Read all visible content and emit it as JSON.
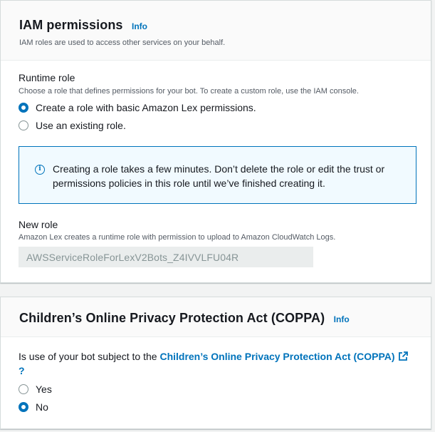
{
  "iam": {
    "title": "IAM permissions",
    "info": "Info",
    "description": "IAM roles are used to access other services on your behalf.",
    "runtime_role": {
      "label": "Runtime role",
      "description": "Choose a role that defines permissions for your bot. To create a custom role, use the IAM console.",
      "options": [
        {
          "label": "Create a role with basic Amazon Lex permissions.",
          "selected": true
        },
        {
          "label": "Use an existing role.",
          "selected": false
        }
      ]
    },
    "alert": {
      "icon": "info-circle-icon",
      "text": "Creating a role takes a few minutes. Don’t delete the role or edit the trust or permissions policies in this role until we’ve finished creating it."
    },
    "new_role": {
      "label": "New role",
      "description": "Amazon Lex creates a runtime role with permission to upload to Amazon CloudWatch Logs.",
      "value": "AWSServiceRoleForLexV2Bots_Z4IVVLFU04R"
    }
  },
  "coppa": {
    "title": "Children’s Online Privacy Protection Act (COPPA)",
    "info": "Info",
    "question_prefix": "Is use of your bot subject to the ",
    "question_link": "Children’s Online Privacy Protection Act (COPPA)",
    "question_suffix": "?",
    "link_icon": "external-link-icon",
    "options": [
      {
        "label": "Yes",
        "selected": false
      },
      {
        "label": "No",
        "selected": true
      }
    ]
  },
  "colors": {
    "accent": "#0073bb",
    "text": "#16191f",
    "secondary_text": "#545b64",
    "alert_bg": "#f1faff"
  }
}
